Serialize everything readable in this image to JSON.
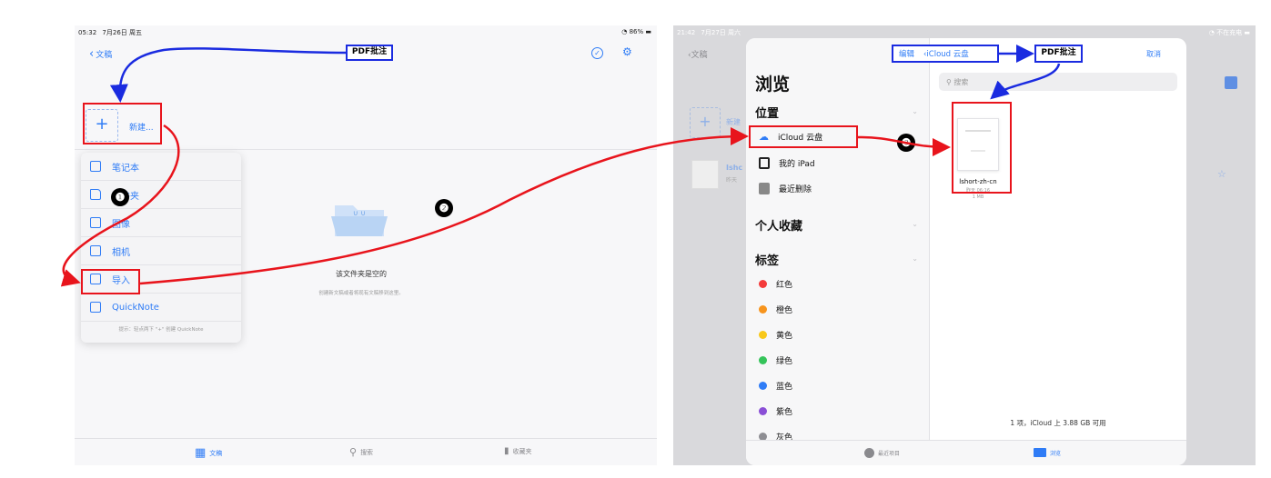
{
  "left": {
    "status": {
      "time": "05:32",
      "date": "7月26日 周五",
      "battery": "86%"
    },
    "back_label": "文稿",
    "annotation_title": "PDF批注",
    "new_label": "新建...",
    "menu": [
      {
        "label": "笔记本",
        "icon": "notebook-icon"
      },
      {
        "label": "文件夹",
        "icon": "folder-icon"
      },
      {
        "label": "图像",
        "icon": "image-icon"
      },
      {
        "label": "相机",
        "icon": "camera-icon"
      },
      {
        "label": "导入",
        "icon": "import-icon"
      },
      {
        "label": "QuickNote",
        "icon": "quicknote-icon"
      }
    ],
    "menu_hint": "提示：轻点两下 \"+\" 创建 QuickNote",
    "empty_title": "该文件夹是空的",
    "empty_sub": "创建新文稿或者将现有文稿移到这里。",
    "tabs": [
      {
        "label": "文稿",
        "icon": "grid-icon",
        "active": true
      },
      {
        "label": "搜索",
        "icon": "search-icon",
        "active": false
      },
      {
        "label": "收藏夹",
        "icon": "bookmark-icon",
        "active": false
      }
    ]
  },
  "right": {
    "status": {
      "time": "21:42",
      "date": "7月27日 周六",
      "battery": "不在充电"
    },
    "back_label": "文稿",
    "new_label": "新建",
    "behind_item": "Ishc",
    "behind_sub": "昨天",
    "edit_label": "编辑",
    "cloud_back": "iCloud 云盘",
    "annotation_title": "PDF批注",
    "cancel_label": "取消",
    "browse_title": "浏览",
    "search_placeholder": "搜索",
    "sections": {
      "locations": "位置",
      "favorites": "个人收藏",
      "tags": "标签"
    },
    "locations": [
      {
        "label": "iCloud 云盘",
        "icon": "cloud-icon"
      },
      {
        "label": "我的 iPad",
        "icon": "ipad-icon"
      },
      {
        "label": "最近删除",
        "icon": "trash-icon"
      }
    ],
    "tags": [
      {
        "label": "红色",
        "color": "#f43b3b"
      },
      {
        "label": "橙色",
        "color": "#f7941d"
      },
      {
        "label": "黄色",
        "color": "#f8c81a"
      },
      {
        "label": "绿色",
        "color": "#35c45a"
      },
      {
        "label": "蓝色",
        "color": "#2f7cf6"
      },
      {
        "label": "紫色",
        "color": "#8a4fd6"
      },
      {
        "label": "灰色",
        "color": "#8e8e93"
      }
    ],
    "file": {
      "name": "lshort-zh-cn",
      "date": "昨天 06:16",
      "size": "1 MB"
    },
    "footer": "1 项，iCloud 上 3.88 GB 可用",
    "tabs": [
      {
        "label": "最近项目",
        "icon": "clock-icon"
      },
      {
        "label": "浏览",
        "icon": "folder-icon"
      }
    ]
  },
  "steps": [
    "❶",
    "❷",
    "❸"
  ]
}
